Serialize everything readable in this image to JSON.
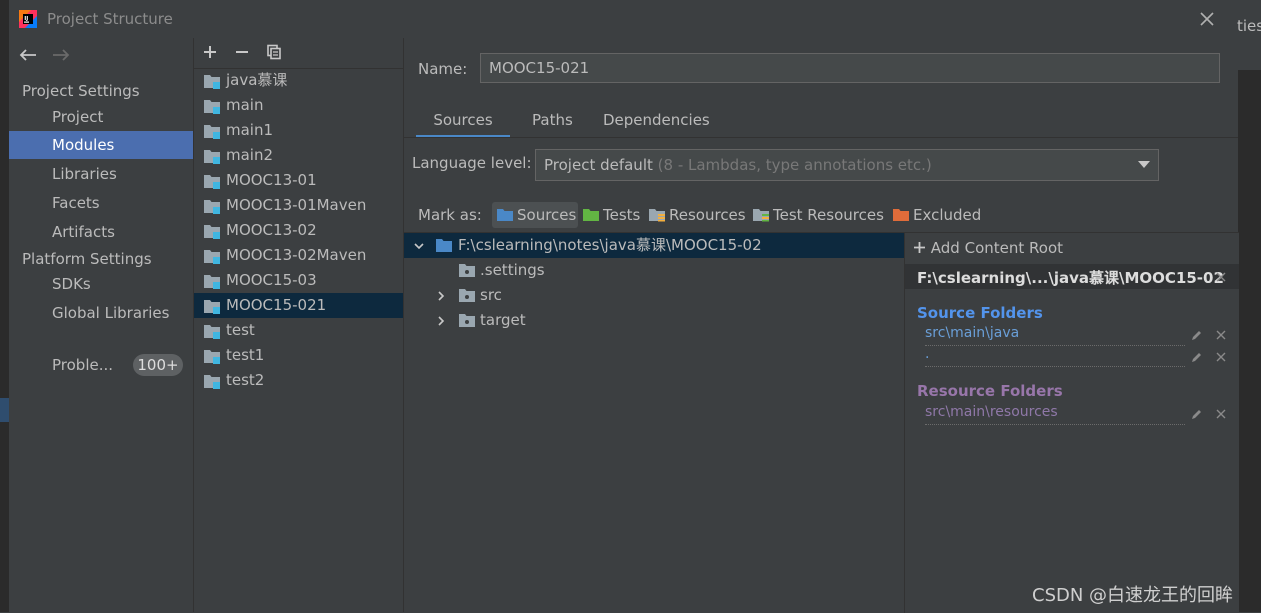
{
  "window": {
    "title": "Project Structure"
  },
  "background": {
    "right_edge_text": "ties"
  },
  "nav": {
    "project_settings_header": "Project Settings",
    "project_settings_items": [
      {
        "label": "Project",
        "selected": false
      },
      {
        "label": "Modules",
        "selected": true
      },
      {
        "label": "Libraries",
        "selected": false
      },
      {
        "label": "Facets",
        "selected": false
      },
      {
        "label": "Artifacts",
        "selected": false
      }
    ],
    "platform_settings_header": "Platform Settings",
    "platform_settings_items": [
      {
        "label": "SDKs"
      },
      {
        "label": "Global Libraries"
      }
    ],
    "problems": {
      "label": "Proble...",
      "count": "100+"
    }
  },
  "modules": [
    {
      "label": "java慕课",
      "selected": false
    },
    {
      "label": "main",
      "selected": false
    },
    {
      "label": "main1",
      "selected": false
    },
    {
      "label": "main2",
      "selected": false
    },
    {
      "label": "MOOC13-01",
      "selected": false
    },
    {
      "label": "MOOC13-01Maven",
      "selected": false
    },
    {
      "label": "MOOC13-02",
      "selected": false
    },
    {
      "label": "MOOC13-02Maven",
      "selected": false
    },
    {
      "label": "MOOC15-03",
      "selected": false
    },
    {
      "label": "MOOC15-021",
      "selected": true
    },
    {
      "label": "test",
      "selected": false
    },
    {
      "label": "test1",
      "selected": false
    },
    {
      "label": "test2",
      "selected": false
    }
  ],
  "details": {
    "name_label": "Name:",
    "name_value": "MOOC15-021",
    "tabs": [
      {
        "label": "Sources",
        "active": true
      },
      {
        "label": "Paths",
        "active": false
      },
      {
        "label": "Dependencies",
        "active": false
      }
    ],
    "language_level_label": "Language level:",
    "language_level_value": "Project default",
    "language_level_hint": "(8 - Lambdas, type annotations etc.)",
    "mark_as_label": "Mark as:",
    "mark_buttons": [
      {
        "label": "Sources",
        "color": "#4a88c7"
      },
      {
        "label": "Tests",
        "color": "#62b543"
      },
      {
        "label": "Resources",
        "color": "#9aa7b0"
      },
      {
        "label": "Test Resources",
        "color": "#9aa7b0"
      },
      {
        "label": "Excluded",
        "color": "#e06c3a"
      }
    ]
  },
  "tree": [
    {
      "label": "F:\\cslearning\\notes\\java慕课\\MOOC15-02",
      "expanded": true,
      "selected": true
    },
    {
      "label": ".settings",
      "expanded": false,
      "selected": false
    },
    {
      "label": "src",
      "expanded": false,
      "selected": false
    },
    {
      "label": "target",
      "expanded": false,
      "selected": false
    }
  ],
  "content_roots": {
    "add_label": "Add Content Root",
    "root_path": "F:\\cslearning\\...\\java慕课\\MOOC15-02",
    "source_folders_title": "Source Folders",
    "source_folders": [
      "src\\main\\java",
      "."
    ],
    "resource_folders_title": "Resource Folders",
    "resource_folders": [
      "src\\main\\resources"
    ]
  },
  "watermark": "CSDN @白速龙王的回眸",
  "colors": {
    "source_title": "#5394ec",
    "source_entry": "#6a9fd8",
    "resource_title": "#9876aa",
    "resource_entry": "#8f78a8",
    "selection": "#0d293e",
    "nav_selection": "#4b6eaf"
  }
}
